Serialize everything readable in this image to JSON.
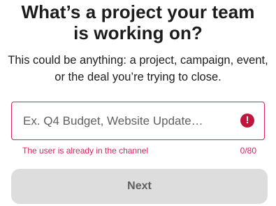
{
  "heading": {
    "line1": "What’s a project your team",
    "line2": "is working on?"
  },
  "subtext": {
    "line1": "This could be anything: a project, campaign, event,",
    "line2": "or the deal you’re trying to close."
  },
  "project_input": {
    "value": "",
    "placeholder": "Ex. Q4 Budget, Website Update…",
    "error_icon": "exclamation-circle-icon",
    "error_glyph": "!"
  },
  "validation": {
    "error_message": "The user is already in the channel",
    "char_count": "0/80"
  },
  "actions": {
    "next_label": "Next"
  },
  "colors": {
    "error": "#e01e5a",
    "button_bg": "#dddddd",
    "button_text": "#616061"
  }
}
